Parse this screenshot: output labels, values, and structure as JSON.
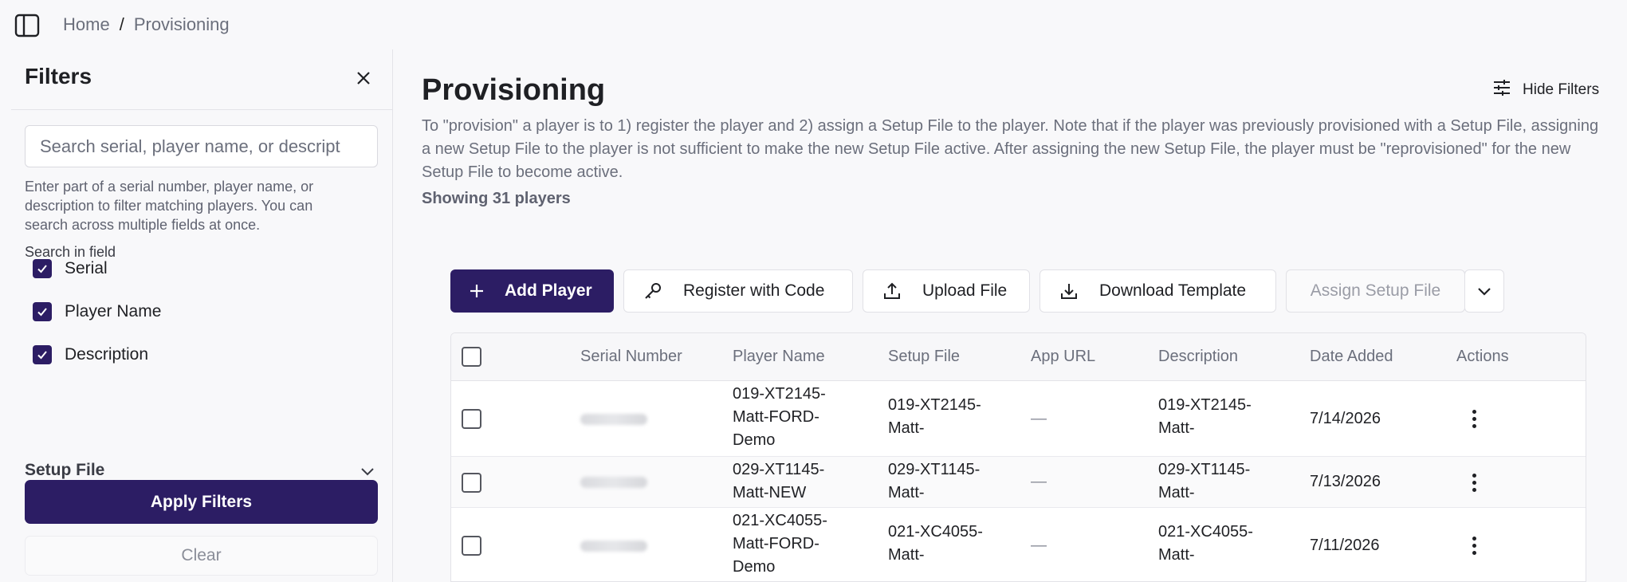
{
  "breadcrumb": {
    "home": "Home",
    "separator": "/",
    "current": "Provisioning"
  },
  "filters": {
    "title": "Filters",
    "search_placeholder": "Search serial, player name, or descript",
    "search_value": "",
    "search_help": "Enter part of a serial number, player name, or description to filter matching players. You can search across multiple fields at once.",
    "search_in_label": "Search in field",
    "fields": [
      {
        "label": "Serial",
        "checked": true
      },
      {
        "label": "Player Name",
        "checked": true
      },
      {
        "label": "Description",
        "checked": true
      }
    ],
    "setup_file_label": "Setup File",
    "apply_label": "Apply Filters",
    "clear_label": "Clear"
  },
  "main": {
    "title": "Provisioning",
    "hide_filters_label": "Hide Filters",
    "description": "To \"provision\" a player is to 1) register the player and 2) assign a Setup File to the player. Note that if the player was previously provisioned with a Setup File, assigning a new Setup File to the player is not sufficient to make the new Setup File active. After assigning the new Setup File, the player must be \"reprovisioned\" for the new Setup File to become active.",
    "showing": "Showing 31 players"
  },
  "toolbar": {
    "add_player": "Add Player",
    "register_with_code": "Register with Code",
    "upload_file": "Upload File",
    "download_template": "Download Template",
    "assign_setup_file": "Assign Setup File"
  },
  "table": {
    "columns": [
      "Serial Number",
      "Player Name",
      "Setup File",
      "App URL",
      "Description",
      "Date Added",
      "Actions"
    ],
    "rows": [
      {
        "player_name": [
          "019-XT2145-",
          "Matt-FORD-",
          "Demo"
        ],
        "setup_file": [
          "019-XT2145-",
          "Matt-"
        ],
        "app_url": "—",
        "description": [
          "019-XT2145-",
          "Matt-"
        ],
        "date_added": "7/14/2026"
      },
      {
        "player_name": [
          "029-XT1145-",
          "Matt-NEW"
        ],
        "setup_file": [
          "029-XT1145-",
          "Matt-"
        ],
        "app_url": "—",
        "description": [
          "029-XT1145-",
          "Matt-"
        ],
        "date_added": "7/13/2026"
      },
      {
        "player_name": [
          "021-XC4055-",
          "Matt-FORD-",
          "Demo"
        ],
        "setup_file": [
          "021-XC4055-",
          "Matt-"
        ],
        "app_url": "—",
        "description": [
          "021-XC4055-",
          "Matt-"
        ],
        "date_added": "7/11/2026"
      }
    ]
  },
  "colors": {
    "brand": "#2c1d64",
    "border": "#e3e3e8",
    "muted_text": "#6b6f7c"
  }
}
